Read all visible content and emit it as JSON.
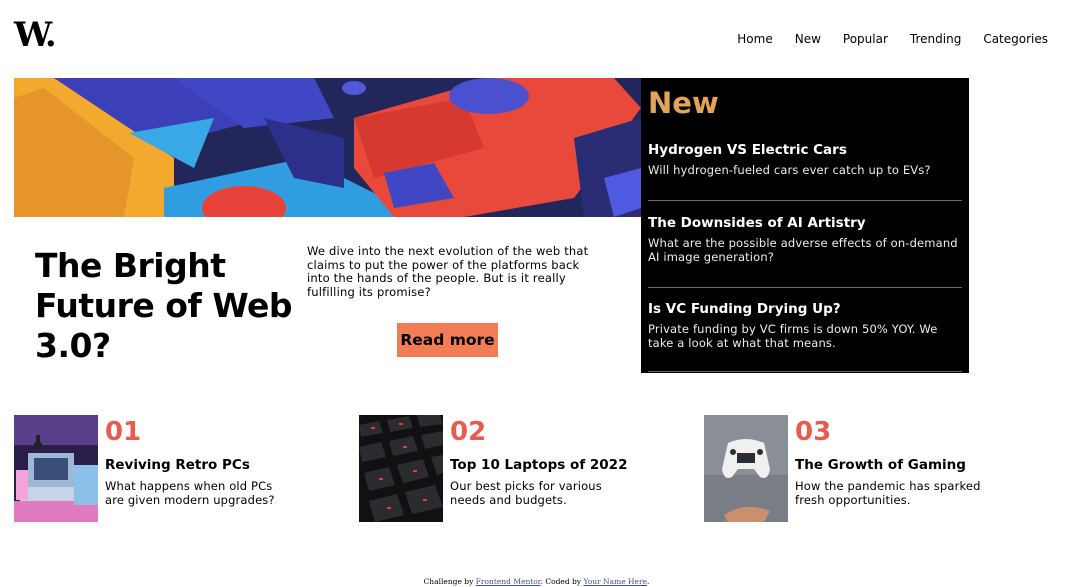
{
  "brand": {
    "logo": "W."
  },
  "nav": {
    "items": [
      {
        "label": "Home"
      },
      {
        "label": "New"
      },
      {
        "label": "Popular"
      },
      {
        "label": "Trending"
      },
      {
        "label": "Categories"
      }
    ]
  },
  "hero": {
    "headline": "The Bright Future of Web 3.0?",
    "description": "We dive into the next evolution of the web that claims to put the power of the platforms back into the hands of the people. But is it really fulfilling its promise?",
    "cta_label": "Read more",
    "image_icon": "abstract-3d-shapes-image"
  },
  "new_panel": {
    "title": "New",
    "items": [
      {
        "title": "Hydrogen VS Electric Cars",
        "desc": "Will hydrogen-fueled cars ever catch up to EVs?"
      },
      {
        "title": "The Downsides of AI Artistry",
        "desc": "What are the possible adverse effects of on-demand AI image generation?"
      },
      {
        "title": "Is VC Funding Drying Up?",
        "desc": "Private funding by VC firms is down 50% YOY. We take a look at what that means."
      }
    ]
  },
  "cards": [
    {
      "num": "01",
      "title": "Reviving Retro PCs",
      "desc": "What happens when old PCs are given modern upgrades?",
      "image_icon": "retro-pc-image"
    },
    {
      "num": "02",
      "title": "Top 10 Laptops of 2022",
      "desc": "Our best picks for various needs and budgets.",
      "image_icon": "keyboard-image"
    },
    {
      "num": "03",
      "title": "The Growth of Gaming",
      "desc": "How the pandemic has sparked fresh opportunities.",
      "image_icon": "gamepad-image"
    }
  ],
  "footer": {
    "prefix": "Challenge by ",
    "link1": "Frontend Mentor",
    "middle": ". Coded by ",
    "link2": "Your Name Here",
    "suffix": "."
  },
  "colors": {
    "accent_orange": "#f27d55",
    "number_red": "#eb5a4e",
    "new_gold": "#e4a456",
    "panel_black": "#000000"
  }
}
